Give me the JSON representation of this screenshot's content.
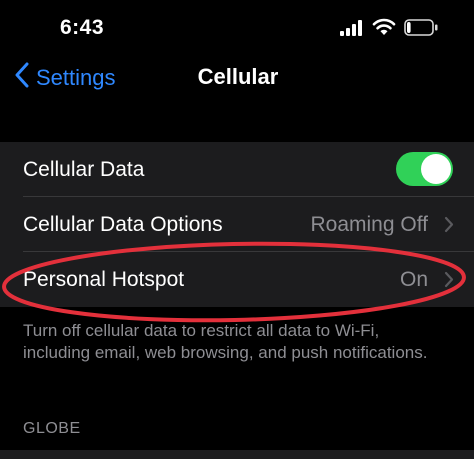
{
  "status_bar": {
    "time": "6:43",
    "signal_icon": "cellular-signal-icon",
    "wifi_icon": "wifi-icon",
    "battery_icon": "battery-icon",
    "battery_level": 0.15
  },
  "nav": {
    "back_label": "Settings",
    "back_icon": "chevron-left-icon",
    "title": "Cellular",
    "accent_color": "#2f88ff"
  },
  "rows": [
    {
      "label": "Cellular Data",
      "toggle_on": true
    },
    {
      "label": "Cellular Data Options",
      "value": "Roaming Off"
    },
    {
      "label": "Personal Hotspot",
      "value": "On"
    }
  ],
  "footer_text": "Turn off cellular data to restrict all data to Wi-Fi, including email, web browsing, and push notifications.",
  "group_header": "GLOBE",
  "colors": {
    "background": "#000000",
    "cell_background": "#1c1c1e",
    "toggle_on": "#30d158",
    "secondary_text": "#8e8e93",
    "annotation_ring": "#e3303b"
  }
}
